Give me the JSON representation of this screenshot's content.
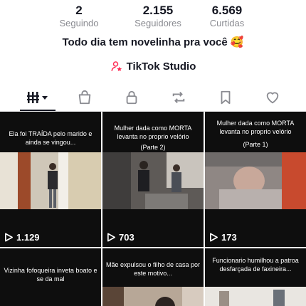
{
  "stats": [
    {
      "value": "2",
      "label": "Seguindo"
    },
    {
      "value": "2.155",
      "label": "Seguidores"
    },
    {
      "value": "6.569",
      "label": "Curtidas"
    }
  ],
  "bio": "Todo dia tem novelinha pra você 🥰",
  "studio": {
    "label": "TikTok Studio"
  },
  "tabs": [
    "videos-icon",
    "shop-icon",
    "lock-icon",
    "repost-icon",
    "bookmark-icon",
    "heart-icon"
  ],
  "videos": [
    {
      "caption": "Ela foi TRAÍDA pelo marido e ainda se vingou...",
      "subtitle": "",
      "views": "1.129"
    },
    {
      "caption": "Mulher dada como MORTA levanta no proprio velório",
      "subtitle": "(Parte 2)",
      "views": "703"
    },
    {
      "caption": "Mulher dada como MORTA levanta no proprio velório",
      "subtitle": "(Parte 1)",
      "views": "173"
    },
    {
      "caption": "Vizinha fofoqueira inveta boato e se da mal",
      "subtitle": "",
      "views": ""
    },
    {
      "caption": "Mãe expulsou o filho de casa por este motivo...",
      "subtitle": "",
      "views": ""
    },
    {
      "caption": "Funcionario humilhou a patroa desfarçada de faxineira...",
      "subtitle": "",
      "views": ""
    }
  ]
}
